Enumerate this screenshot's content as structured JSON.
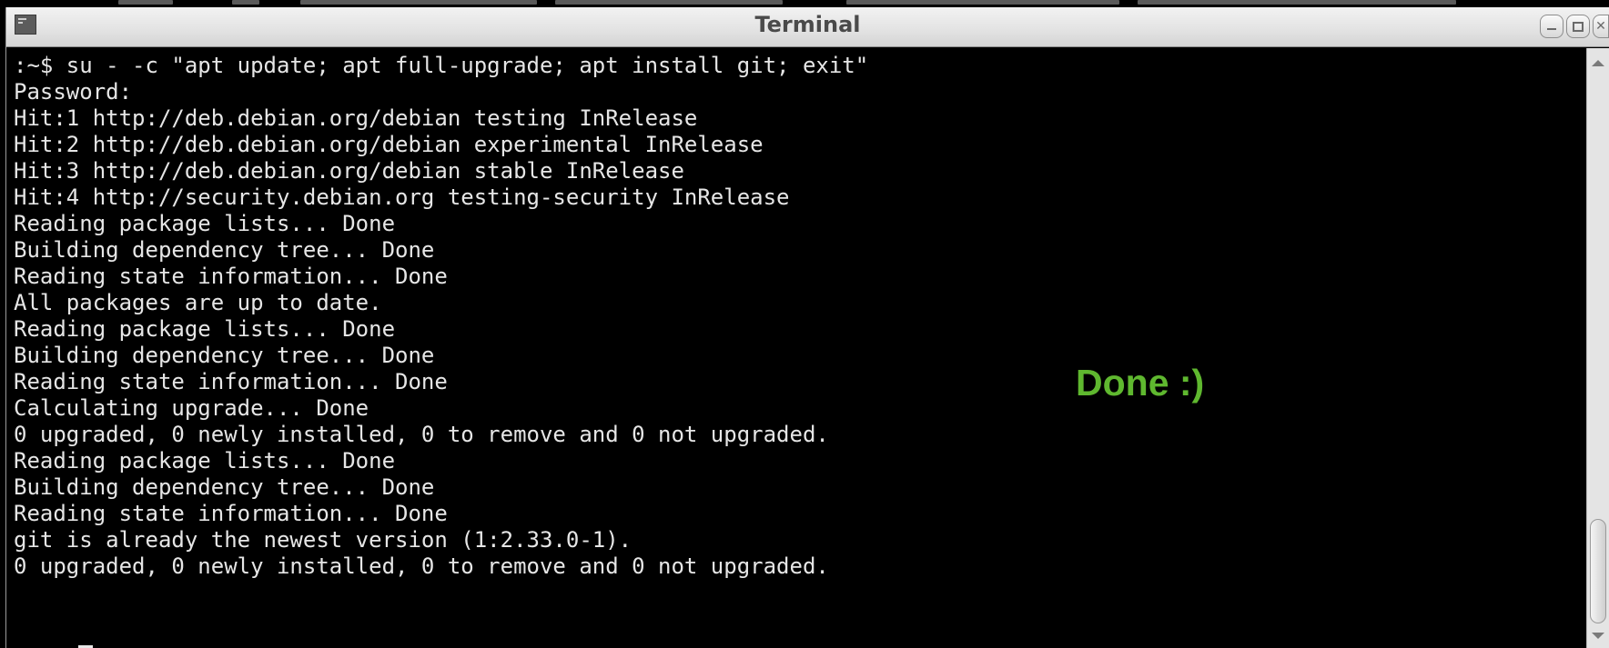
{
  "window": {
    "title": "Terminal"
  },
  "icons": {
    "app": "terminal-app-icon",
    "minimize": "minimize-icon",
    "maximize": "maximize-icon",
    "close": "close-icon",
    "scroll_up": "scroll-up-arrow-icon",
    "scroll_down": "scroll-down-arrow-icon"
  },
  "terminal": {
    "lines": [
      ":~$ su - -c \"apt update; apt full-upgrade; apt install git; exit\"",
      "Password:",
      "Hit:1 http://deb.debian.org/debian testing InRelease",
      "Hit:2 http://deb.debian.org/debian experimental InRelease",
      "Hit:3 http://deb.debian.org/debian stable InRelease",
      "Hit:4 http://security.debian.org testing-security InRelease",
      "Reading package lists... Done",
      "Building dependency tree... Done",
      "Reading state information... Done",
      "All packages are up to date.",
      "Reading package lists... Done",
      "Building dependency tree... Done",
      "Reading state information... Done",
      "Calculating upgrade... Done",
      "0 upgraded, 0 newly installed, 0 to remove and 0 not upgraded.",
      "Reading package lists... Done",
      "Building dependency tree... Done",
      "Reading state information... Done",
      "git is already the newest version (1:2.33.0-1).",
      "0 upgraded, 0 newly installed, 0 to remove and 0 not upgraded."
    ]
  },
  "annotation": {
    "text": "Done :)"
  },
  "colors": {
    "terminal_bg": "#000000",
    "terminal_fg": "#e6e6e6",
    "annotation": "#5fb82f",
    "titlebar": "#e4e4e4"
  }
}
